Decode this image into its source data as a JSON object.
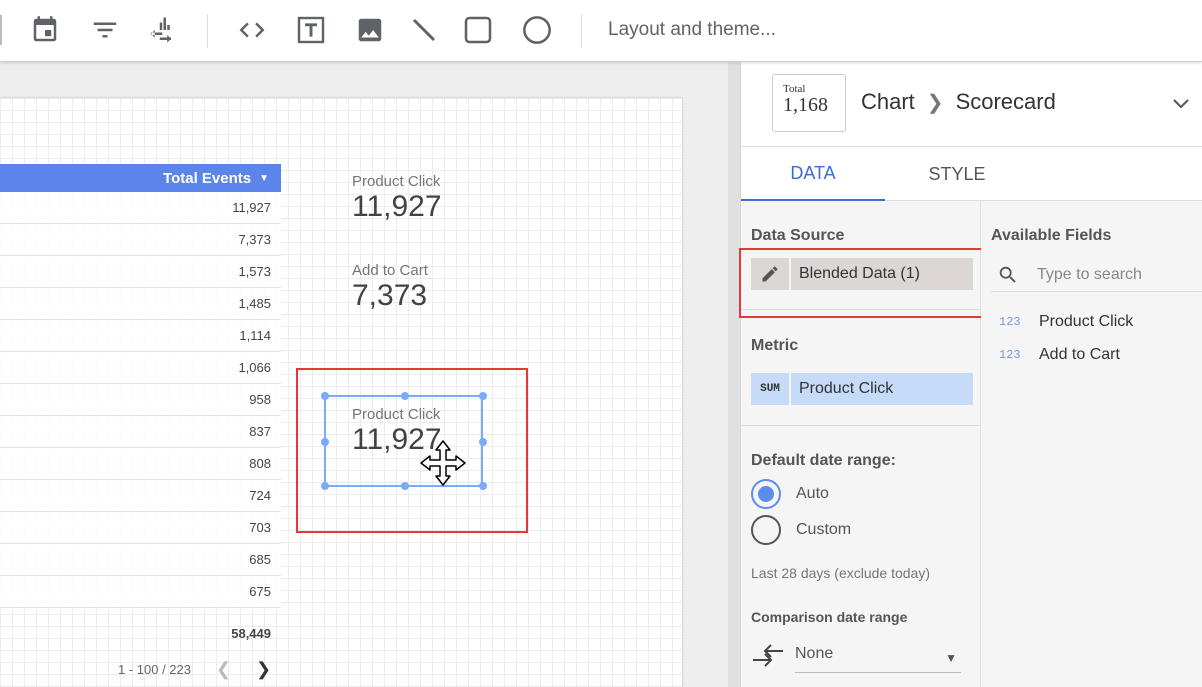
{
  "toolbar": {
    "icons": [
      "date-range-icon",
      "filter-icon",
      "data-control-icon",
      "embed-url-icon",
      "text-box-icon",
      "image-icon",
      "line-icon",
      "rectangle-icon",
      "circle-icon"
    ],
    "layout_theme_label": "Layout and theme..."
  },
  "table": {
    "header": "Total Events",
    "rows": [
      "11,927",
      "7,373",
      "1,573",
      "1,485",
      "1,114",
      "1,066",
      "958",
      "837",
      "808",
      "724",
      "703",
      "685",
      "675"
    ],
    "total": "58,449",
    "pagination": "1 - 100 / 223"
  },
  "scorecards": [
    {
      "label": "Product Click",
      "value": "11,927"
    },
    {
      "label": "Add to Cart",
      "value": "7,373"
    },
    {
      "label": "Product Click",
      "value": "11,927"
    }
  ],
  "panel": {
    "thumbnail": {
      "label": "Total",
      "value": "1,168"
    },
    "breadcrumb": {
      "parent": "Chart",
      "current": "Scorecard"
    },
    "tabs": [
      "DATA",
      "STYLE"
    ],
    "data_source": {
      "title": "Data Source",
      "name": "Blended Data (1)"
    },
    "metric": {
      "title": "Metric",
      "aggregation": "SUM",
      "name": "Product Click"
    },
    "date_range": {
      "title": "Default date range:",
      "options": [
        "Auto",
        "Custom"
      ],
      "selected": "Auto",
      "hint": "Last 28 days (exclude today)"
    },
    "comparison": {
      "title": "Comparison date range",
      "value": "None"
    },
    "available_fields": {
      "title": "Available Fields",
      "search_placeholder": "Type to search",
      "fields": [
        {
          "type": "123",
          "name": "Product Click"
        },
        {
          "type": "123",
          "name": "Add to Cart"
        }
      ]
    }
  },
  "colors": {
    "accent": "#5c85ec",
    "highlight": "#e53935",
    "selection": "#7baaf7"
  }
}
